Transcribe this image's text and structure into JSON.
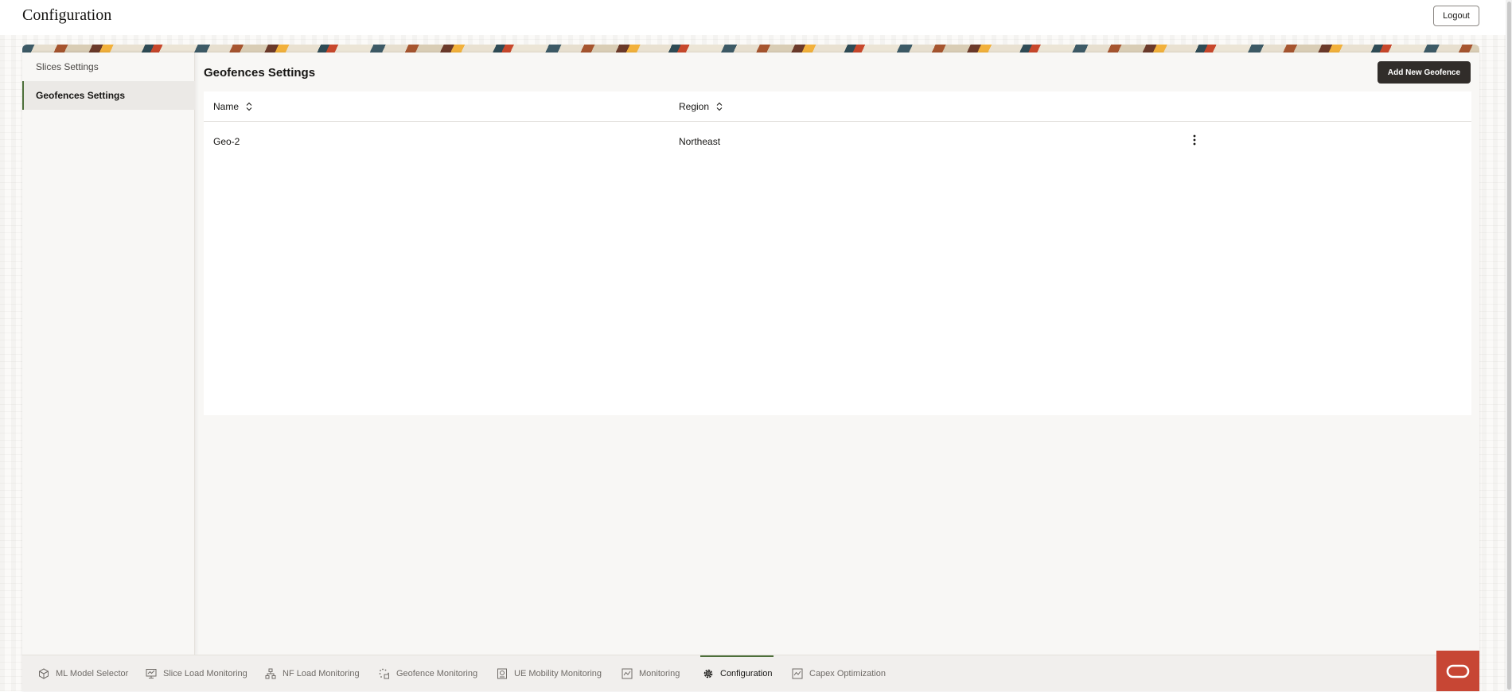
{
  "header": {
    "title": "Configuration",
    "logout_label": "Logout"
  },
  "sidebar": {
    "items": [
      {
        "label": "Slices Settings",
        "active": false
      },
      {
        "label": "Geofences Settings",
        "active": true
      }
    ]
  },
  "main": {
    "section_title": "Geofences Settings",
    "add_button_label": "Add New Geofence",
    "table": {
      "columns": [
        "Name",
        "Region"
      ],
      "rows": [
        {
          "name": "Geo-2",
          "region": "Northeast"
        }
      ]
    }
  },
  "bottom_nav": {
    "items": [
      {
        "label": "ML Model Selector",
        "icon": "cube-icon"
      },
      {
        "label": "Slice Load Monitoring",
        "icon": "monitor-icon"
      },
      {
        "label": "NF Load Monitoring",
        "icon": "network-icon"
      },
      {
        "label": "Geofence Monitoring",
        "icon": "geofence-icon"
      },
      {
        "label": "UE Mobility Monitoring",
        "icon": "device-icon"
      },
      {
        "label": "Monitoring",
        "icon": "chart-icon"
      },
      {
        "label": "Configuration",
        "icon": "gear-icon",
        "active": true
      },
      {
        "label": "Capex Optimization",
        "icon": "chart-icon"
      }
    ]
  },
  "colors": {
    "accent": "#4d6f3a",
    "primary_button": "#312d2a",
    "brand_red": "#c74634",
    "surface": "#f8f7f5"
  }
}
